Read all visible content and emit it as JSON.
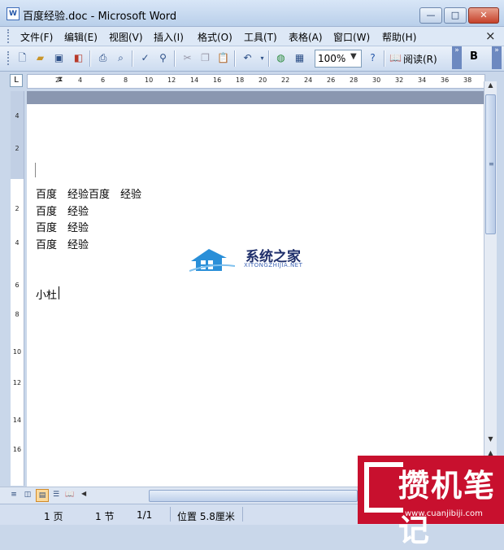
{
  "window": {
    "icon_letter": "W",
    "title": "百度经验.doc - Microsoft Word",
    "min_glyph": "—",
    "max_glyph": "□",
    "close_glyph": "✕"
  },
  "menu": {
    "items": [
      "文件(F)",
      "编辑(E)",
      "视图(V)",
      "插入(I)",
      "格式(O)",
      "工具(T)",
      "表格(A)",
      "窗口(W)",
      "帮助(H)"
    ],
    "close_doc": "×"
  },
  "toolbar": {
    "zoom": "100%",
    "zoom_arrow": "▼",
    "read_label": "阅读(R)",
    "bold": "B",
    "overflow": "»"
  },
  "ruler": {
    "ticks": [
      "2",
      "4",
      "6",
      "8",
      "10",
      "12",
      "14",
      "16",
      "18",
      "20",
      "22",
      "24",
      "26",
      "28",
      "30",
      "32",
      "34",
      "36",
      "38"
    ],
    "tab_selector": "L"
  },
  "vruler": {
    "ticks": [
      "4",
      "2",
      "2",
      "4",
      "6",
      "8",
      "10",
      "12",
      "14",
      "16"
    ]
  },
  "document": {
    "lines": [
      "百度　经验百度　经验",
      "百度　经验",
      "百度　经验",
      "百度　经验",
      "小杜"
    ]
  },
  "watermark": {
    "cn": "系统之家",
    "en": "XITONGZHIJIA.NET"
  },
  "status": {
    "page": "1 页",
    "section": "1 节",
    "pages": "1/1",
    "position": "位置 5.8厘米"
  },
  "corner_logo": {
    "cn": "攒机笔记",
    "url": "www.cuanjibiji.com"
  },
  "colors": {
    "accent_red": "#c8102e",
    "titlebar": "#c9d9ee",
    "page_margin": "#8a97b0"
  }
}
